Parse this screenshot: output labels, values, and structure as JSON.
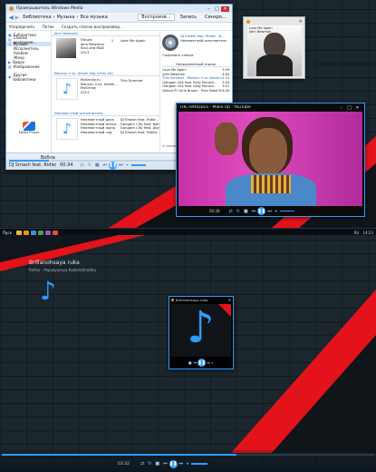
{
  "media_player": {
    "title": "Проигрыватель Windows Media",
    "breadcrumb": [
      "Библиотека",
      "Музыка",
      "Все музыка"
    ],
    "tabs": [
      "Воспроизв...",
      "Запись",
      "Синхро..."
    ],
    "toolbar": {
      "arrange": "Упорядочить",
      "stream": "Поток",
      "create_playlist": "Создать список воспроизвед..."
    },
    "nav": [
      {
        "label": "Библиотека"
      },
      {
        "label": "Списки воспроизв..."
      },
      {
        "label": "Музыка"
      },
      {
        "label": "Исполнитель"
      },
      {
        "label": "Альбом"
      },
      {
        "label": "Жанр"
      },
      {
        "label": "Видео"
      },
      {
        "label": "Изображения"
      },
      {
        "label": "Другие библиотеки"
      }
    ],
    "albums": [
      {
        "header": "John Newman",
        "lines": [
          "Tribute",
          "John Newman",
          "Soul and R&B",
          "2013"
        ],
        "track_no": "1",
        "track": "Love Me Again"
      },
      {
        "header": "Mansun li vs. Alexei Veg (Vinly ed)",
        "lines": [
          "MyKrinky.ru",
          "Mansun li vs. Alexei...",
          "MyKrinky",
          "2013"
        ],
        "track_no": "",
        "track": "This Summer"
      },
      {
        "header": "Неизвестный исполнитель",
        "lines": [
          "Неизвестный диск",
          "Неизвестный испол...",
          "Неизвестный жанр",
          "Неизвестный год"
        ],
        "track_no": "",
        "track": "DJ Smash feat. Ridle..."
      }
    ],
    "extra_tracks": [
      "Gangam City feat. Kelly Sm...",
      "Gangam City feat. Aby Mn...",
      "DJ Smash feat. Ridley - В..."
    ],
    "right_panel": {
      "now_title": "DJ Smash feat. Ridley - В...",
      "now_sub": "Неизвестный исполнитель",
      "save_label": "Сохранить список",
      "list_header": "Несохраненный список",
      "playlist": [
        {
          "title": "Love Me Again",
          "time": "3:59"
        },
        {
          "title": "John Newman",
          "time": "4:00"
        },
        {
          "title": "This Summer - Mansun li vs. Alexei Veg...",
          "time": "4:24"
        },
        {
          "title": "Gangam City feat. Kelly Muroch...",
          "time": "3:34"
        },
        {
          "title": "Gangam City feat. Kelly Muroch...",
          "time": "3:51"
        },
        {
          "title": "Dolore Pl Chris Brown - Pure Make Ri...",
          "time": "3:44"
        }
      ],
      "count": "6 элементов, 23 минуты"
    },
    "sidebar_logo": "Media Player",
    "now_playing_label": "Вобла",
    "now_playing_sub": "DJ Smash feat. Ridley",
    "time": "00:34"
  },
  "mini_art_window": {
    "overlay_title": "Love Me Again",
    "overlay_sub": "John Newman"
  },
  "video_window": {
    "title": "THE HARDEES - Make Up - YouTube",
    "time": "00:28"
  },
  "taskbar": {
    "start_label": "Пуск",
    "tray": "RU",
    "clock": "14:23"
  },
  "desktop_now_playing": {
    "title": "Brillanohsaya ruka",
    "subtitle": "Reflex - Popsdyansya RadioVkfrakfka"
  },
  "small_player": {
    "title": "Brillanohsaya ruka"
  },
  "bottom_bar": {
    "time": "03:32"
  },
  "colors": {
    "accent": "#2f9cff",
    "red": "#e3121b",
    "dark_bg": "#1b262d",
    "video_pink": "#d63aa8"
  },
  "icons": [
    "music-note-icon",
    "play-icon",
    "pause-icon",
    "prev-icon",
    "next-icon",
    "stop-icon",
    "shuffle-icon",
    "repeat-icon",
    "volume-icon",
    "close-icon",
    "minimize-icon",
    "maximize-icon",
    "media-player-logo-icon"
  ]
}
